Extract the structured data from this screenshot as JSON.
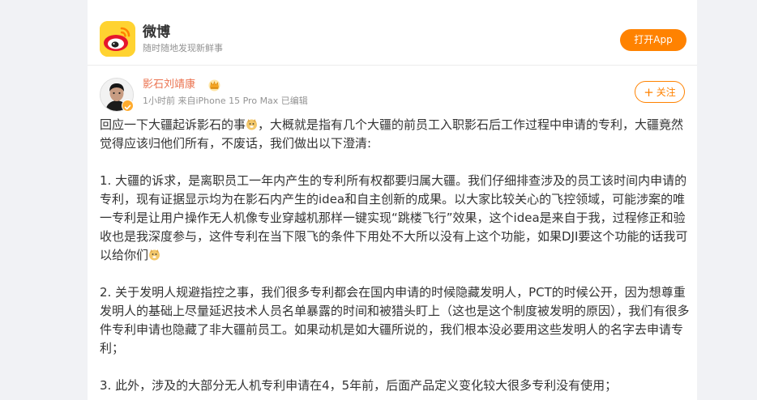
{
  "header": {
    "app_name": "微博",
    "slogan": "随时随地发现新鲜事",
    "open_app": "打开App"
  },
  "post": {
    "author": "影石刘靖康",
    "meta": "1小时前 来自iPhone 15 Pro Max 已编辑",
    "follow": "关注",
    "p1_a": "回应一下大疆起诉影石的事",
    "p1_b": "，大概就是指有几个大疆的前员工入职影石后工作过程中申请的专利，大疆竟然觉得应该归他们所有，不废话，我们做出以下澄清:",
    "p2_a": "1. 大疆的诉求，是离职员工一年内产生的专利所有权都要归属大疆。我们仔细排查涉及的员工该时间内申请的专利，现有证据显示均为在影石内产生的idea和自主创新的成果。以大家比较关心的飞控领域，可能涉案的唯一专利是让用户操作无人机像专业穿越机那样一键实现“跳楼飞行”效果，这个idea是来自于我，过程修正和验收也是我深度参与，这件专利在当下限飞的条件下用处不大所以没有上这个功能，如果DJI要这个功能的话我可以给你们",
    "p3": "2. 关于发明人规避指控之事，我们很多专利都会在国内申请的时候隐藏发明人，PCT的时候公开，因为想尊重发明人的基础上尽量延迟技术人员名单暴露的时间和被猎头盯上（这也是这个制度被发明的原因），我们有很多件专利申请也隐藏了非大疆前员工。如果动机是如大疆所说的，我们根本没必要用这些发明人的名字去申请专利；",
    "p4": "3. 此外，涉及的大部分无人机专利申请在4，5年前，后面产品定义变化较大很多专利没有使用；"
  },
  "icons": {
    "logo": "weibo-logo-icon",
    "crown": "crown-icon",
    "verify": "verified-badge-icon",
    "emoji": "doge-emoji-icon"
  },
  "colors": {
    "accent": "#ff8200",
    "author": "#eb7350",
    "text": "#333333",
    "muted": "#939393"
  }
}
